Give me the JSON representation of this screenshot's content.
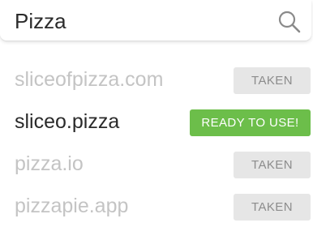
{
  "search": {
    "query": "Pizza",
    "icon": "search-icon"
  },
  "colors": {
    "taken_text": "#c4c4c4",
    "available_text": "#2a2a2a",
    "taken_badge_bg": "#e6e6e6",
    "taken_badge_text": "#8c8c8c",
    "ready_badge_bg": "#6cbe4a",
    "ready_badge_text": "#ffffff"
  },
  "results": [
    {
      "domain": "sliceofpizza.com",
      "status": "TAKEN"
    },
    {
      "domain": "sliceo.pizza",
      "status": "READY TO USE!"
    },
    {
      "domain": "pizza.io",
      "status": "TAKEN"
    },
    {
      "domain": "pizzapie.app",
      "status": "TAKEN"
    }
  ]
}
